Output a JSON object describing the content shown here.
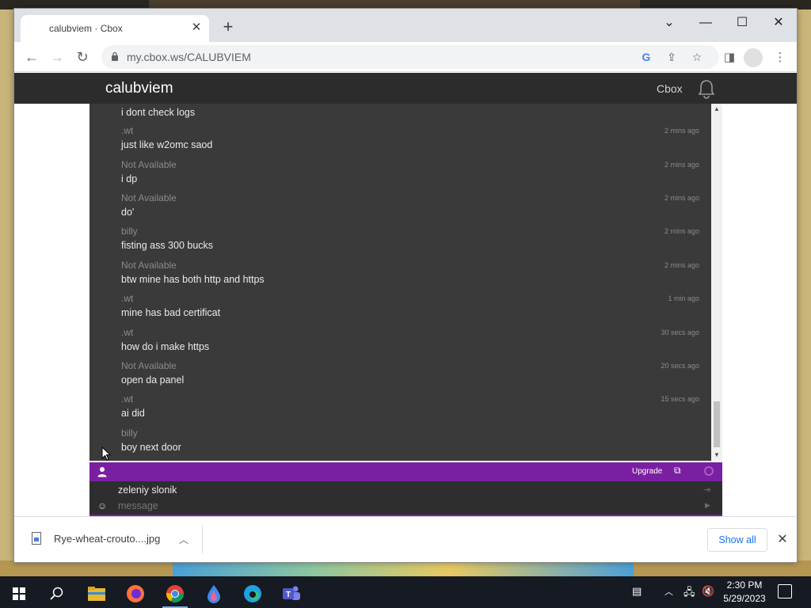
{
  "browser": {
    "tab_title": "calubviem · Cbox",
    "url": "my.cbox.ws/CALUBVIEM"
  },
  "site": {
    "title": "calubviem",
    "header_link": "Cbox"
  },
  "messages": [
    {
      "user": "",
      "text": "i dont check logs",
      "time": ""
    },
    {
      "user": ".wt",
      "text": "just like w2omc saod",
      "time": "2 mins ago"
    },
    {
      "user": "Not Available",
      "text": "i dp",
      "time": "2 mins ago"
    },
    {
      "user": "Not Available",
      "text": "do'",
      "time": "2 mins ago"
    },
    {
      "user": "billy",
      "text": "fisting ass 300 bucks",
      "time": "2 mins ago"
    },
    {
      "user": "Not Available",
      "text": "btw mine has both http and https",
      "time": "2 mins ago"
    },
    {
      "user": ".wt",
      "text": "mine has bad certificat",
      "time": "1 min ago"
    },
    {
      "user": ".wt",
      "text": "how do i make https",
      "time": "30 secs ago"
    },
    {
      "user": "Not Available",
      "text": "open da panel",
      "time": "20 secs ago"
    },
    {
      "user": ".wt",
      "text": "ai did",
      "time": "15 secs ago"
    },
    {
      "user": "billy",
      "text": "boy next door",
      "time": ""
    }
  ],
  "chat_bar": {
    "upgrade_label": "Upgrade"
  },
  "compose": {
    "name": "zeleniy slonik",
    "placeholder": "message"
  },
  "downloads": {
    "file_name": "Rye-wheat-crouto....jpg",
    "show_all_label": "Show all"
  },
  "taskbar": {
    "time": "2:30 PM",
    "date": "5/29/2023"
  },
  "colors": {
    "chat_bg": "#3a3a3a",
    "accent_purple": "#7b1fa2",
    "header_bg": "#2c2c2c"
  }
}
